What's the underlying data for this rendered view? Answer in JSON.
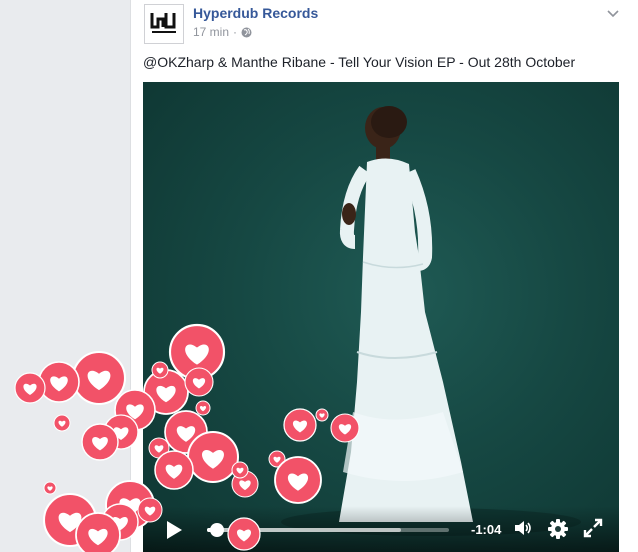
{
  "post": {
    "page_name": "Hyperdub Records",
    "timestamp": "17 min",
    "separator": "·",
    "privacy_icon": "globe-icon",
    "menu_icon": "chevron-down-icon",
    "text": "@OKZharp & Manthe Ribane - Tell Your Vision EP - Out 28th October"
  },
  "video": {
    "time_remaining": "-1:04",
    "progress": 0.04,
    "buffered": 0.8,
    "controls": {
      "play_icon": "play-icon",
      "volume_icon": "volume-icon",
      "settings_icon": "gear-icon",
      "fullscreen_icon": "fullscreen-icon"
    }
  },
  "reactions": {
    "type": "love",
    "icon": "heart-icon",
    "color": "#f25268"
  },
  "colors": {
    "link": "#365899",
    "meta": "#90949c",
    "text": "#1d2129",
    "video_bg": "#164843",
    "heart_bg": "#f25268"
  }
}
